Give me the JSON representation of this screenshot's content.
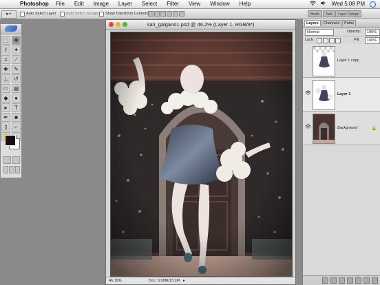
{
  "menubar": {
    "app_name": "Photoshop",
    "menus": [
      "File",
      "Edit",
      "Image",
      "Layer",
      "Select",
      "Filter",
      "View",
      "Window",
      "Help"
    ],
    "clock": "Wed 5:08 PM"
  },
  "options": {
    "auto_select_layer": "Auto Select Layer",
    "auto_select_groups": "Auto Select Groups",
    "show_transform_controls": "Show Transform Controls",
    "well_tabs": [
      "Brush",
      "Tool",
      "Layer Comps"
    ]
  },
  "document": {
    "title": "san_galgano1.psd @ 46.2% (Layer 1, RGB/8*)",
    "zoom": "46.19%",
    "doc_size": "Doc: 3.99M/13.1M"
  },
  "layers_panel": {
    "tabs": [
      "Layers",
      "Channels",
      "Paths"
    ],
    "blend_mode": "Normal",
    "opacity_label": "Opacity:",
    "opacity": "100%",
    "lock_label": "Lock:",
    "fill_label": "Fill:",
    "fill": "100%",
    "layers": [
      {
        "name": "Layer 1 copy",
        "visible": false,
        "selected": false
      },
      {
        "name": "Layer 1",
        "visible": true,
        "selected": true
      },
      {
        "name": "Background",
        "visible": true,
        "selected": false
      }
    ]
  },
  "colors": {
    "foreground": "#1a0f0f",
    "background": "#ffffff",
    "selection_accent": "#3875d7"
  }
}
